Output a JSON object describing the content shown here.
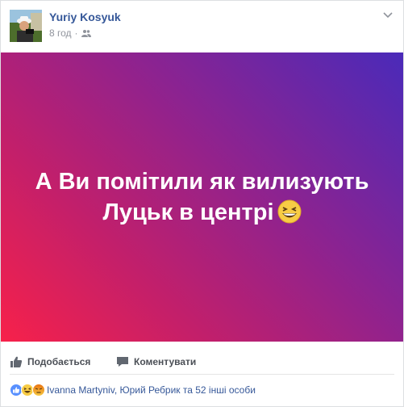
{
  "post": {
    "author": "Yuriy Kosyuk",
    "time": "8 год",
    "separator": "·",
    "privacy_icon": "friends-icon",
    "menu_icon": "chevron-down-icon"
  },
  "banner": {
    "text": "А Ви помітили як вилизують Луцьк в центрі",
    "emoji": "grinning-squinting-face-emoji",
    "colors": {
      "gradient_start": "#f7214a",
      "gradient_end": "#4a2ab9"
    }
  },
  "actions": {
    "like_label": "Подобається",
    "comment_label": "Коментувати"
  },
  "reactions": {
    "icons": [
      "like-icon",
      "haha-icon",
      "angry-icon"
    ],
    "summary": "Ivanna Martyniv, Юрий Ребрик та 52 інші особи"
  },
  "colors": {
    "link": "#365899",
    "muted": "#90949c",
    "like_blue": "#5890ff",
    "reaction_yellow": "#f7cc45",
    "angry_red": "#e9710f"
  }
}
